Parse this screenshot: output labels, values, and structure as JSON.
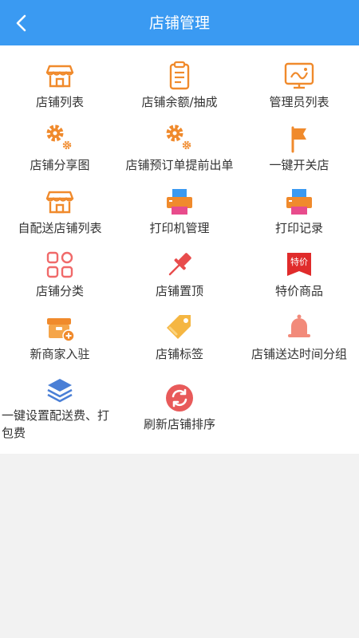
{
  "header": {
    "title": "店铺管理",
    "back_icon": "chevron-left-icon"
  },
  "colors": {
    "header_bg": "#3a9af2",
    "orange": "#f08a2c",
    "red": "#e84c4c",
    "pink": "#f06a6a",
    "blue": "#4a7fd6"
  },
  "grid": [
    {
      "name": "shop-list",
      "label": "店铺列表",
      "icon": "store-icon"
    },
    {
      "name": "shop-balance",
      "label": "店铺余额/抽成",
      "icon": "clipboard-icon"
    },
    {
      "name": "admin-list",
      "label": "管理员列表",
      "icon": "monitor-icon"
    },
    {
      "name": "shop-share-image",
      "label": "店铺分享图",
      "icon": "gear-icon"
    },
    {
      "name": "shop-preorder",
      "label": "店铺预订单提前出单",
      "icon": "gear-icon"
    },
    {
      "name": "one-key-open-close",
      "label": "一键开关店",
      "icon": "flag-icon"
    },
    {
      "name": "self-delivery-shop-list",
      "label": "自配送店铺列表",
      "icon": "store-icon"
    },
    {
      "name": "printer-manage",
      "label": "打印机管理",
      "icon": "printer-icon"
    },
    {
      "name": "print-records",
      "label": "打印记录",
      "icon": "printer-icon"
    },
    {
      "name": "shop-category",
      "label": "店铺分类",
      "icon": "grid-icon"
    },
    {
      "name": "shop-pin-top",
      "label": "店铺置顶",
      "icon": "pushpin-icon"
    },
    {
      "name": "special-price-goods",
      "label": "特价商品",
      "icon": "price-tag-badge-icon",
      "badge_text": "特价"
    },
    {
      "name": "new-merchant-join",
      "label": "新商家入驻",
      "icon": "merchant-add-icon"
    },
    {
      "name": "shop-tags",
      "label": "店铺标签",
      "icon": "tag-icon"
    },
    {
      "name": "delivery-time-group",
      "label": "店铺送达时间分组",
      "icon": "bell-icon"
    },
    {
      "name": "one-key-delivery-fee",
      "label": "一键设置配送费、打包费",
      "label_line1": "一键设置配送费、打",
      "label_line2": "包费",
      "icon": "layers-icon"
    },
    {
      "name": "refresh-shop-sort",
      "label": "刷新店铺排序",
      "icon": "refresh-icon"
    }
  ]
}
